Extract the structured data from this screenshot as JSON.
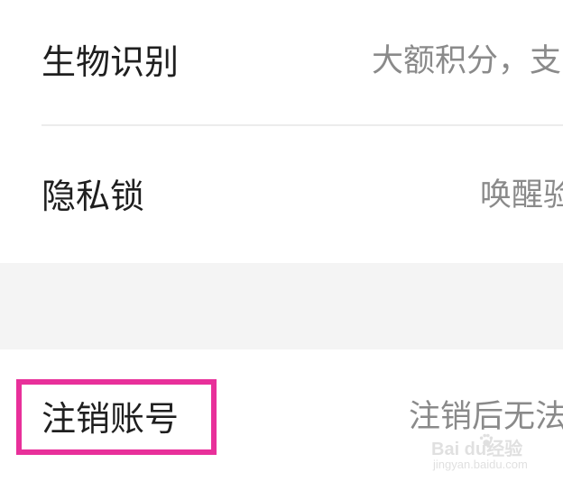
{
  "settings": {
    "items": [
      {
        "label": "生物识别",
        "hint": "大额积分，支"
      },
      {
        "label": "隐私锁",
        "hint": "唤醒验"
      },
      {
        "label": "注销账号",
        "hint": "注销后无法"
      }
    ]
  },
  "watermark": {
    "logo": "Bai du经验",
    "sub": "jingyan.baidu.com"
  },
  "colors": {
    "highlight": "#e8309a",
    "section_gap": "#f4f4f4",
    "hint_text": "#8a8a8a",
    "label_text": "#1f1f1f"
  }
}
